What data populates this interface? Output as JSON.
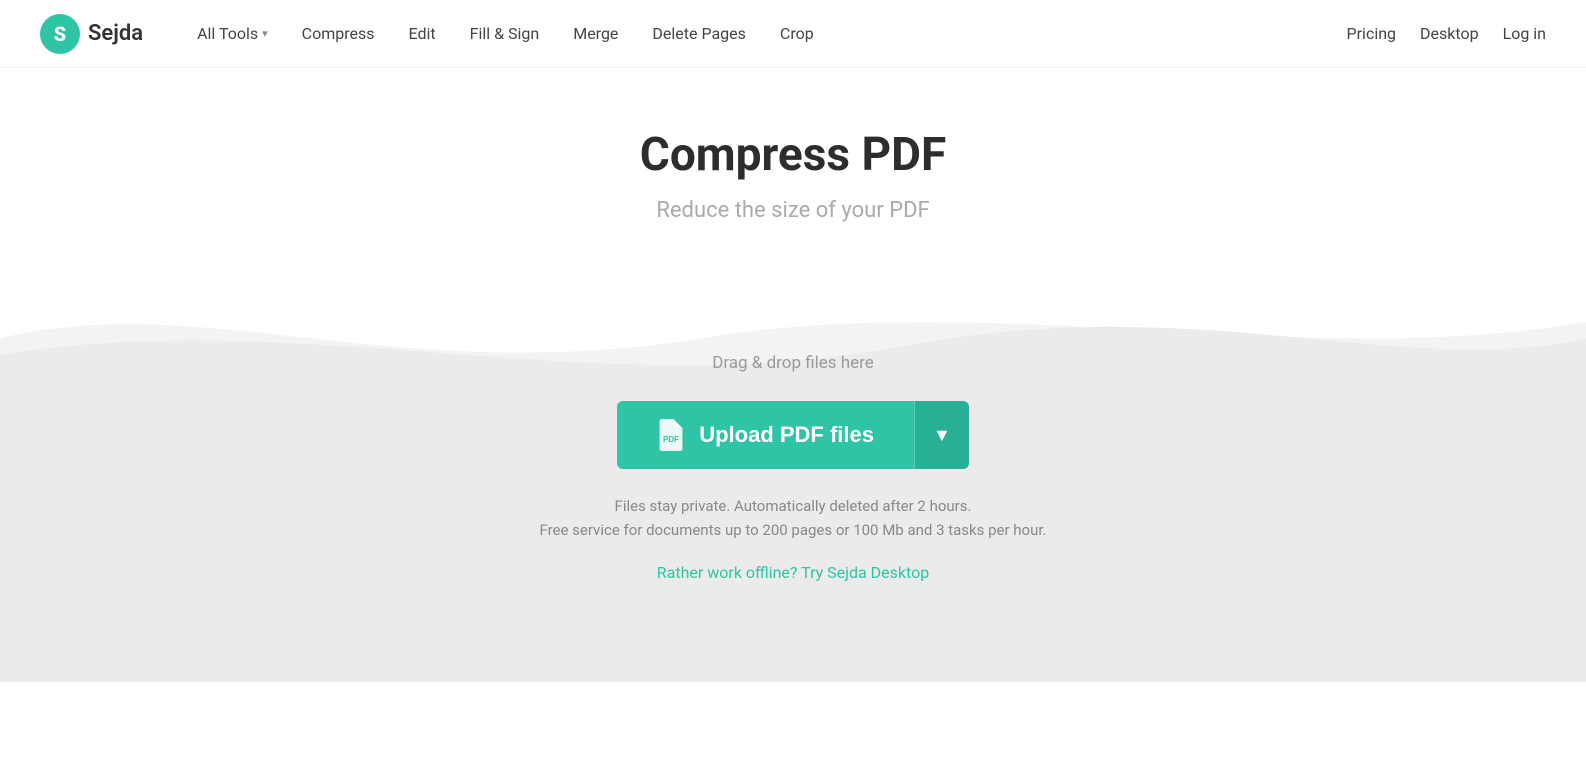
{
  "logo": {
    "letter": "S",
    "name": "Sejda"
  },
  "nav": {
    "main_items": [
      {
        "label": "All Tools",
        "has_dropdown": true
      },
      {
        "label": "Compress",
        "has_dropdown": false
      },
      {
        "label": "Edit",
        "has_dropdown": false
      },
      {
        "label": "Fill & Sign",
        "has_dropdown": false
      },
      {
        "label": "Merge",
        "has_dropdown": false
      },
      {
        "label": "Delete Pages",
        "has_dropdown": false
      },
      {
        "label": "Crop",
        "has_dropdown": false
      }
    ],
    "right_items": [
      {
        "label": "Pricing"
      },
      {
        "label": "Desktop"
      },
      {
        "label": "Log in"
      }
    ]
  },
  "hero": {
    "title": "Compress PDF",
    "subtitle": "Reduce the size of your PDF"
  },
  "upload": {
    "drag_drop_text": "Drag & drop files here",
    "button_main_label": "Upload PDF files",
    "button_dropdown_label": "▼",
    "privacy_text": "Files stay private. Automatically deleted after 2 hours.",
    "free_service_text": "Free service for documents up to 200 pages or 100 Mb and 3 tasks per hour.",
    "offline_link_text": "Rather work offline? Try Sejda Desktop"
  }
}
